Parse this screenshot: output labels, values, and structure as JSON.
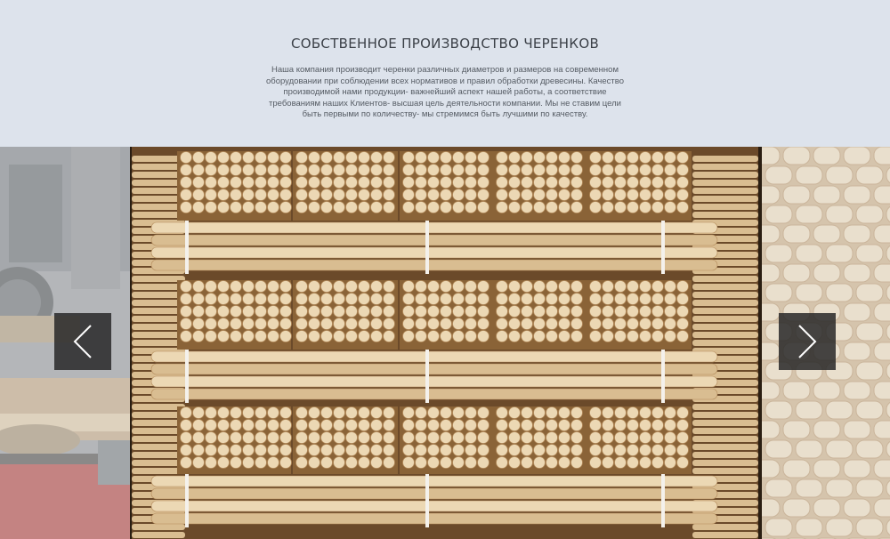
{
  "intro": {
    "title": "СОБСТВЕННОЕ ПРОИЗВОДСТВО ЧЕРЕНКОВ",
    "description": "Наша компания производит черенки различных диаметров и размеров на современном оборудовании при соблюдении всех нормативов и правил обработки древесины. Качество производимой нами продукции- важнейший аспект нашей работы, а соответствие требованиям наших Клиентов- высшая цель деятельности компании. Мы не ставим цели быть первыми по количеству- мы стремимся быть лучшими по качеству."
  },
  "slider": {
    "prev_icon": "chevron-left-icon",
    "next_icon": "chevron-right-icon"
  },
  "colors": {
    "background": "#dde3ec",
    "title": "#3a3f46",
    "text": "#555b63",
    "wood_light": "#e8d3ae",
    "wood_dark": "#c9a878",
    "nav_button": "#282828"
  }
}
